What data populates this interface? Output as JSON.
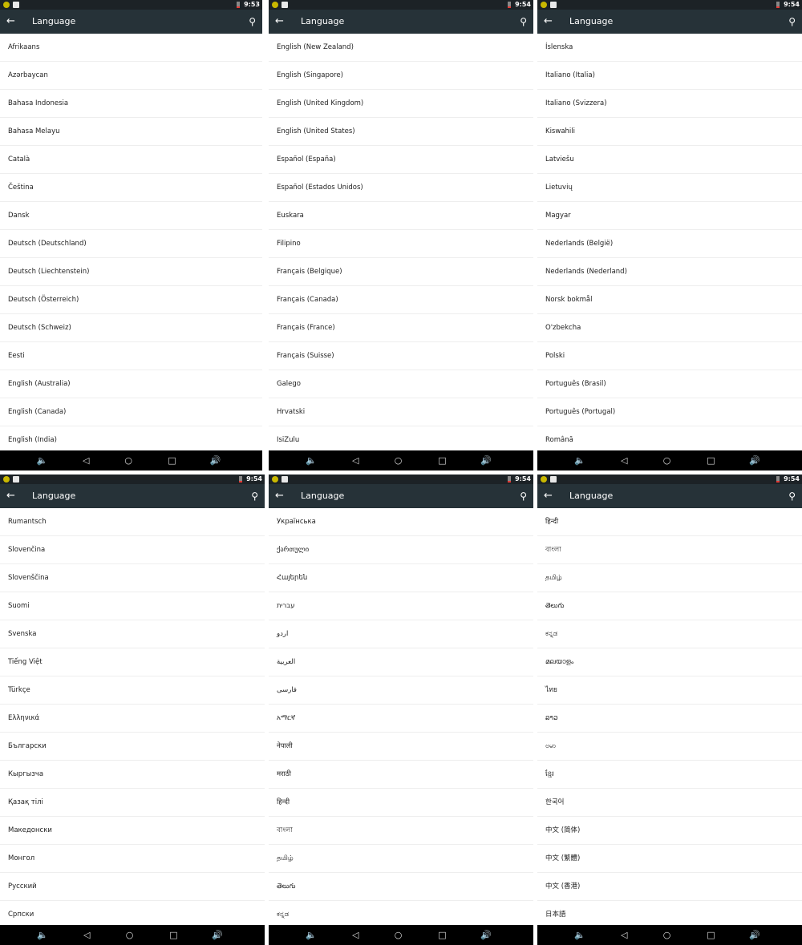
{
  "title": "Language",
  "colors": {
    "status_bar": "#1c2226",
    "toolbar": "#263238",
    "nav_bar": "#000000",
    "divider": "#eeeeee"
  },
  "icons": {
    "back": "arrow-left-icon",
    "search": "search-icon",
    "nav": [
      "volume-down-icon",
      "back-triangle-icon",
      "home-circle-icon",
      "recents-square-icon",
      "volume-up-icon"
    ]
  },
  "screens": [
    {
      "time": "9:53",
      "items": [
        "Afrikaans",
        "Azərbaycan",
        "Bahasa Indonesia",
        "Bahasa Melayu",
        "Català",
        "Čeština",
        "Dansk",
        "Deutsch (Deutschland)",
        "Deutsch (Liechtenstein)",
        "Deutsch (Österreich)",
        "Deutsch (Schweiz)",
        "Eesti",
        "English (Australia)",
        "English (Canada)",
        "English (India)"
      ]
    },
    {
      "time": "9:54",
      "items": [
        "English (New Zealand)",
        "English (Singapore)",
        "English (United Kingdom)",
        "English (United States)",
        "Español (España)",
        "Español (Estados Unidos)",
        "Euskara",
        "Filipino",
        "Français (Belgique)",
        "Français (Canada)",
        "Français (France)",
        "Français (Suisse)",
        "Galego",
        "Hrvatski",
        "IsiZulu"
      ]
    },
    {
      "time": "9:54",
      "items": [
        "Íslenska",
        "Italiano (Italia)",
        "Italiano (Svizzera)",
        "Kiswahili",
        "Latviešu",
        "Lietuvių",
        "Magyar",
        "Nederlands (België)",
        "Nederlands (Nederland)",
        "Norsk bokmål",
        "O'zbekcha",
        "Polski",
        "Português (Brasil)",
        "Português (Portugal)",
        "Română"
      ]
    },
    {
      "time": "9:54",
      "items": [
        "Rumantsch",
        "Slovenčina",
        "Slovenščina",
        "Suomi",
        "Svenska",
        "Tiếng Việt",
        "Türkçe",
        "Ελληνικά",
        "Български",
        "Кыргызча",
        "Қазақ тілі",
        "Македонски",
        "Монгол",
        "Русский",
        "Српски"
      ]
    },
    {
      "time": "9:54",
      "items": [
        "Українська",
        "ქართული",
        "Հայերեն",
        "עברית",
        "اردو",
        "العربية",
        "فارسی",
        "አማርኛ",
        "नेपाली",
        "मराठी",
        "हिन्दी",
        "বাংলা",
        "தமிழ்",
        "తెలుగు",
        "ಕನ್ನಡ"
      ]
    },
    {
      "time": "9:54",
      "items": [
        "हिन्दी",
        "বাংলা",
        "தமிழ்",
        "తెలుగు",
        "ಕನ್ನಡ",
        "മലയാളം",
        "ไทย",
        "ລາວ",
        "ဗမာ",
        "ខ្មែរ",
        "한국어",
        "中文 (简体)",
        "中文 (繁體)",
        "中文 (香港)",
        "日本語"
      ]
    }
  ]
}
